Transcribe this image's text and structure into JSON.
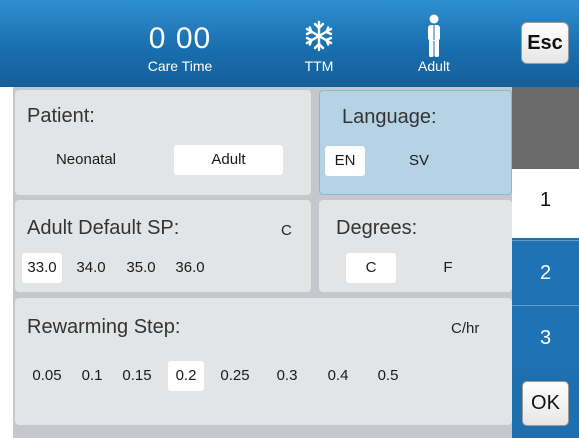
{
  "header": {
    "care_time_value": "0 00",
    "care_time_label": "Care Time",
    "ttm_label": "TTM",
    "ttm_icon": "snowflake-icon",
    "adult_label": "Adult",
    "adult_icon": "person-icon",
    "esc_label": "Esc"
  },
  "patient": {
    "title": "Patient:",
    "options": [
      "Neonatal",
      "Adult"
    ],
    "selected": "Adult"
  },
  "language": {
    "title": "Language:",
    "options": [
      "EN",
      "SV"
    ],
    "selected": "EN"
  },
  "default_sp": {
    "title": "Adult Default SP:",
    "unit": "C",
    "options": [
      "33.0",
      "34.0",
      "35.0",
      "36.0"
    ],
    "selected": "33.0"
  },
  "degrees": {
    "title": "Degrees:",
    "options": [
      "C",
      "F"
    ],
    "selected": "C"
  },
  "rewarming": {
    "title": "Rewarming Step:",
    "unit": "C/hr",
    "options": [
      "0.05",
      "0.1",
      "0.15",
      "0.2",
      "0.25",
      "0.3",
      "0.4",
      "0.5"
    ],
    "selected": "0.2"
  },
  "tabs": [
    "1",
    "2",
    "3"
  ],
  "active_tab": "1",
  "ok_label": "OK",
  "colors": {
    "header_blue": "#1a6fae",
    "tab_blue": "#1f72b3",
    "panel_gray": "#e2e4e6",
    "language_panel": "#b6d3e6"
  }
}
